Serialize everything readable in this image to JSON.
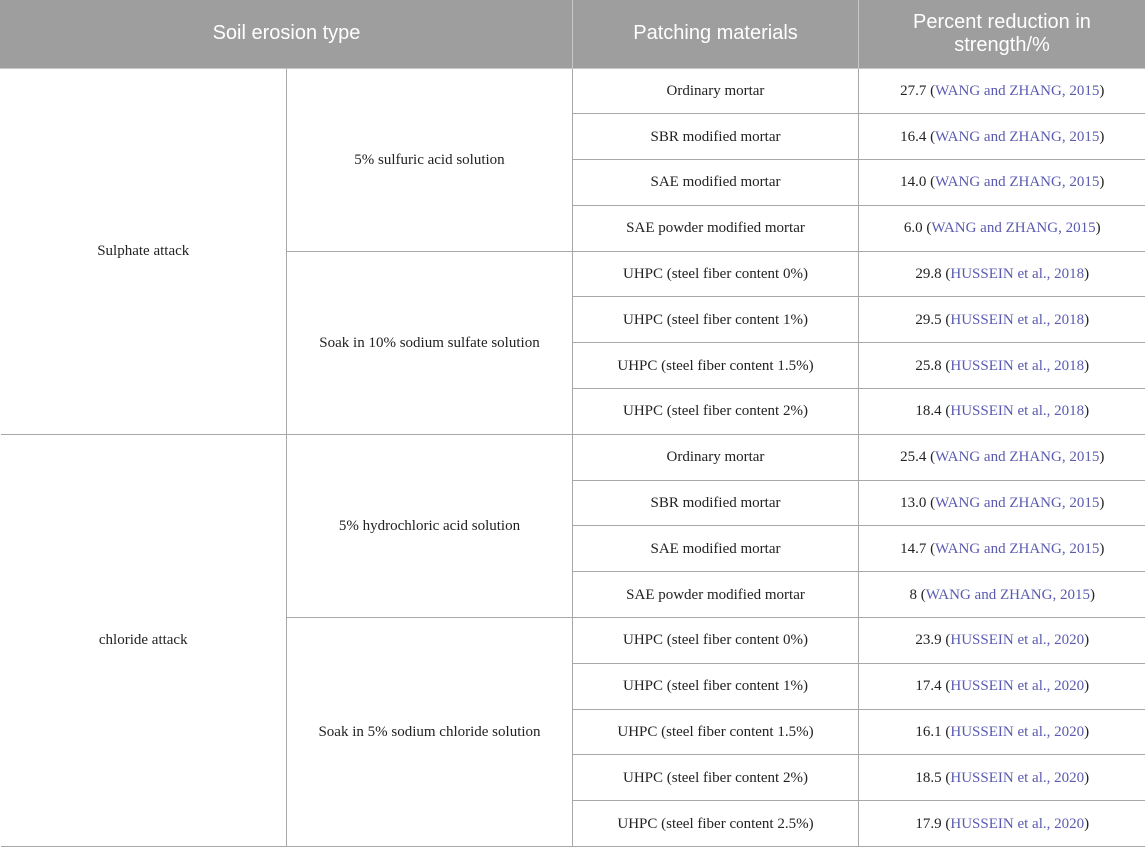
{
  "headers": {
    "erosion_type": "Soil erosion type",
    "materials": "Patching materials",
    "reduction": "Percent reduction in strength/%"
  },
  "groups": [
    {
      "type": "Sulphate attack",
      "subgroups": [
        {
          "solution": "5% sulfuric acid solution",
          "rows": [
            {
              "material": "Ordinary mortar",
              "value": "27.7",
              "ref": "WANG and ZHANG, 2015"
            },
            {
              "material": "SBR modified mortar",
              "value": "16.4",
              "ref": "WANG and ZHANG, 2015"
            },
            {
              "material": "SAE modified mortar",
              "value": "14.0",
              "ref": "WANG and ZHANG, 2015"
            },
            {
              "material": "SAE powder modified mortar",
              "value": "6.0",
              "ref": "WANG and ZHANG, 2015"
            }
          ]
        },
        {
          "solution": "Soak in 10% sodium sulfate solution",
          "rows": [
            {
              "material": "UHPC (steel fiber content 0%)",
              "value": "29.8",
              "ref": "HUSSEIN et al., 2018"
            },
            {
              "material": "UHPC (steel fiber content 1%)",
              "value": "29.5",
              "ref": "HUSSEIN et al., 2018"
            },
            {
              "material": "UHPC (steel fiber content 1.5%)",
              "value": "25.8",
              "ref": "HUSSEIN et al., 2018"
            },
            {
              "material": "UHPC (steel fiber content 2%)",
              "value": "18.4",
              "ref": "HUSSEIN et al., 2018"
            }
          ]
        }
      ]
    },
    {
      "type": "chloride attack",
      "subgroups": [
        {
          "solution": "5% hydrochloric acid solution",
          "rows": [
            {
              "material": "Ordinary mortar",
              "value": "25.4",
              "ref": "WANG and ZHANG, 2015"
            },
            {
              "material": "SBR modified mortar",
              "value": "13.0",
              "ref": "WANG and ZHANG, 2015"
            },
            {
              "material": "SAE modified mortar",
              "value": "14.7",
              "ref": "WANG and ZHANG, 2015"
            },
            {
              "material": "SAE powder modified mortar",
              "value": "8",
              "ref": "WANG and ZHANG, 2015"
            }
          ]
        },
        {
          "solution": "Soak in 5% sodium chloride solution",
          "rows": [
            {
              "material": "UHPC (steel fiber content 0%)",
              "value": "23.9",
              "ref": "HUSSEIN et al., 2020"
            },
            {
              "material": "UHPC (steel fiber content 1%)",
              "value": "17.4",
              "ref": "HUSSEIN et al., 2020"
            },
            {
              "material": "UHPC (steel fiber content 1.5%)",
              "value": "16.1",
              "ref": "HUSSEIN et al., 2020"
            },
            {
              "material": "UHPC (steel fiber content 2%)",
              "value": "18.5",
              "ref": "HUSSEIN et al., 2020"
            },
            {
              "material": "UHPC (steel fiber content 2.5%)",
              "value": "17.9",
              "ref": "HUSSEIN et al., 2020"
            }
          ]
        }
      ]
    }
  ],
  "colors": {
    "header_bg": "#9e9e9e",
    "header_text": "#ffffff",
    "link": "#5a5ab0",
    "border": "#a8a8a8"
  }
}
